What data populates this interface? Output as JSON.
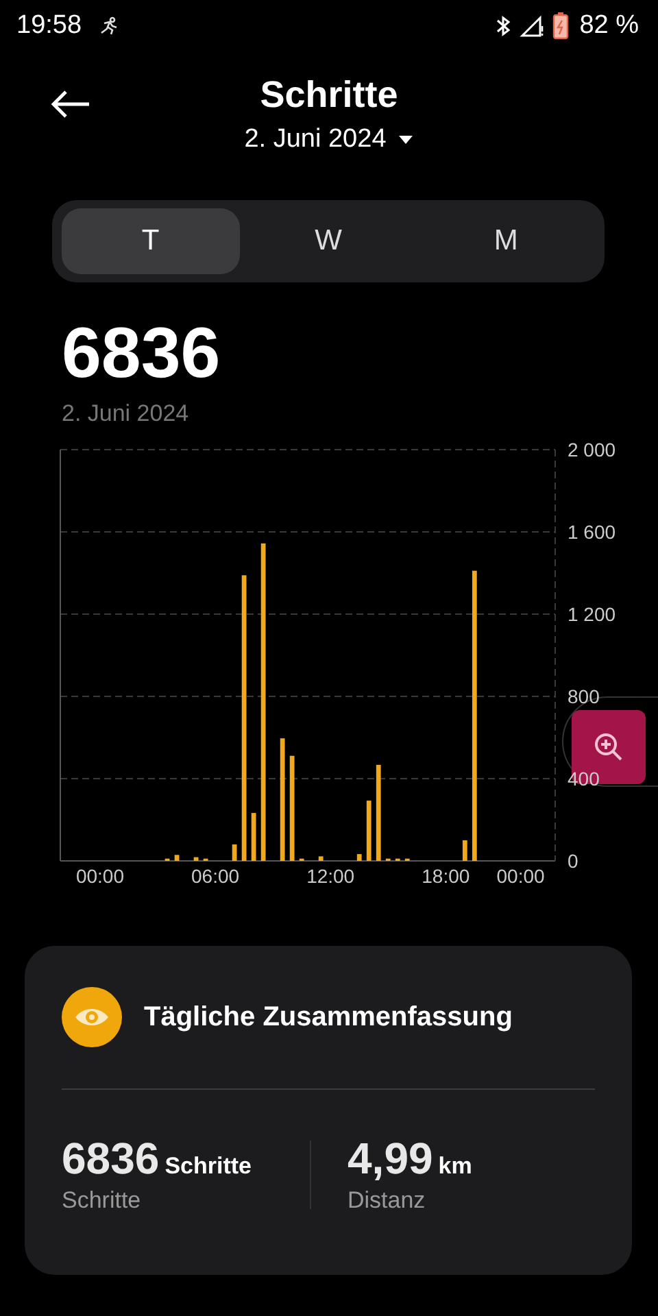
{
  "status_bar": {
    "time": "19:58",
    "battery": "82 %"
  },
  "header": {
    "title": "Schritte",
    "date": "2. Juni 2024"
  },
  "tabs": [
    {
      "label": "T",
      "selected": true
    },
    {
      "label": "W",
      "selected": false
    },
    {
      "label": "M",
      "selected": false
    }
  ],
  "total": {
    "value": "6836",
    "date": "2. Juni 2024"
  },
  "chart_data": {
    "type": "bar",
    "x": [
      3.5,
      4,
      5,
      5.5,
      7,
      7.5,
      8,
      8.5,
      9.5,
      10,
      10.5,
      11.5,
      13.5,
      14,
      14.5,
      15,
      15.5,
      16,
      19,
      19.5
    ],
    "series": [
      {
        "color": "#f2a81d",
        "values": [
          11,
          29,
          18,
          11,
          80,
          1389,
          233,
          1544,
          596,
          511,
          11,
          22,
          33,
          293,
          467,
          11,
          11,
          11,
          100,
          1411
        ]
      }
    ],
    "grid": true,
    "xlim": [
      -2.07,
      23.7
    ],
    "ylim": [
      0,
      2000
    ],
    "xticks": [
      {
        "value": 0,
        "label": "00:00"
      },
      {
        "value": 6,
        "label": "06:00"
      },
      {
        "value": 12,
        "label": "12:00"
      },
      {
        "value": 18,
        "label": "18:00"
      },
      {
        "value": 21.9,
        "label": "00:00"
      }
    ],
    "yticks": [
      {
        "value": 0,
        "label": "0"
      },
      {
        "value": 400,
        "label": "400"
      },
      {
        "value": 800,
        "label": "800"
      },
      {
        "value": 1200,
        "label": "1 200"
      },
      {
        "value": 1600,
        "label": "1 600"
      },
      {
        "value": 2000,
        "label": "2 000"
      }
    ]
  },
  "summary": {
    "title": "Tägliche Zusammenfassung",
    "stats": [
      {
        "value": "6836",
        "unit": "Schritte",
        "label": "Schritte"
      },
      {
        "value": "4,99",
        "unit": "km",
        "label": "Distanz"
      }
    ]
  }
}
